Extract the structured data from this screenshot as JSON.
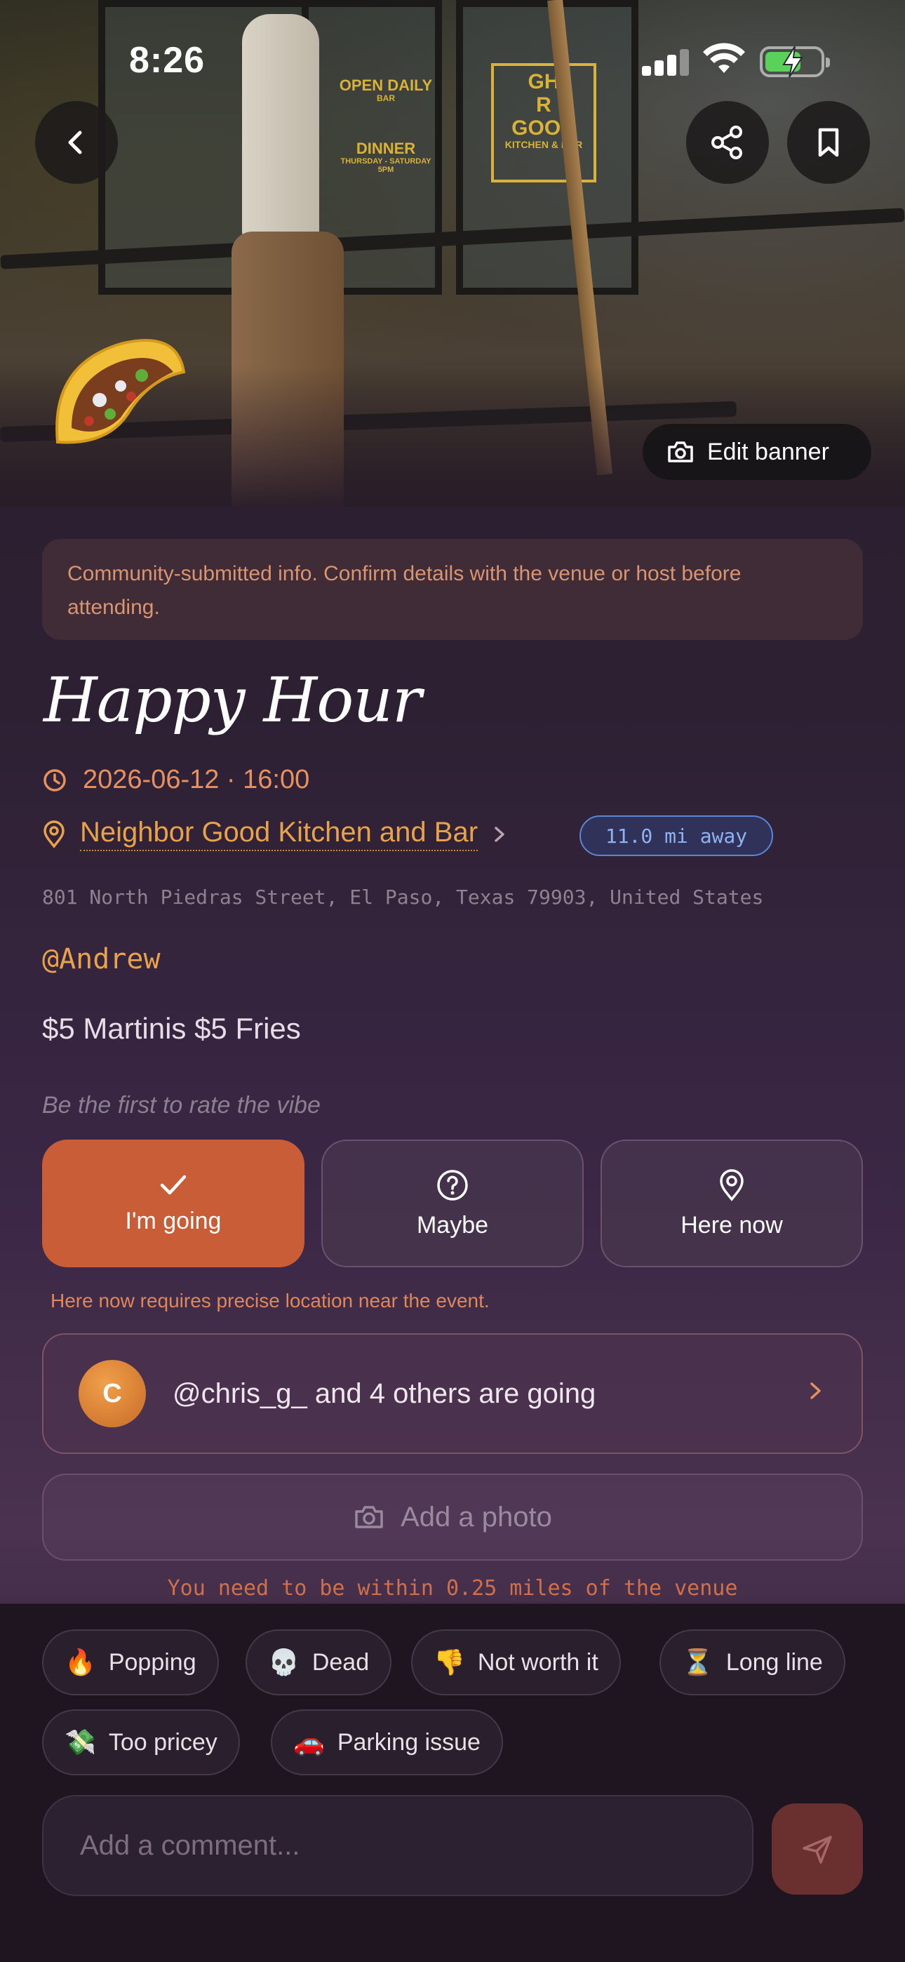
{
  "status_bar": {
    "time": "8:26"
  },
  "banner": {
    "edit_label": "Edit banner",
    "signs": {
      "open_daily": "OPEN DAILY",
      "bar": "BAR",
      "dinner": "DINNER",
      "dinner_days": "THURSDAY - SATURDAY",
      "dinner_time": "5PM",
      "good_1": "GH",
      "good_2": "R",
      "good_3": "GOOD",
      "good_4": "KITCHEN & BAR"
    }
  },
  "notice": "Community-submitted info. Confirm details with the venue or host before attending.",
  "event": {
    "title": "Happy Hour",
    "datetime": "2026-06-12 · 16:00",
    "venue": "Neighbor Good Kitchen and Bar",
    "distance": "11.0 mi away",
    "address": "801 North Piedras Street, El Paso, Texas 79903, United States",
    "host": "@Andrew",
    "description": "$5 Martinis $5 Fries",
    "vibe_prompt": "Be the first to rate the vibe"
  },
  "rsvp": {
    "going": "I'm going",
    "maybe": "Maybe",
    "here_now": "Here now",
    "here_note": "Here now requires precise location near the event."
  },
  "attendees": {
    "avatar_initial": "C",
    "summary": "@chris_g_ and 4 others are going"
  },
  "photo": {
    "add_label": "Add a photo",
    "proximity_note": "You need to be within 0.25 miles of the venue"
  },
  "vibe_chips": [
    {
      "emoji": "🔥",
      "label": "Popping"
    },
    {
      "emoji": "💀",
      "label": "Dead"
    },
    {
      "emoji": "👎",
      "label": "Not worth it"
    },
    {
      "emoji": "⏳",
      "label": "Long line"
    },
    {
      "emoji": "💸",
      "label": "Too pricey"
    },
    {
      "emoji": "🚗",
      "label": "Parking issue"
    }
  ],
  "comment": {
    "placeholder": "Add a comment..."
  },
  "colors": {
    "accent": "#c85d38",
    "venue_link": "#e8a24a",
    "distance_badge": "#5a86d6",
    "background": "#2b1d2d"
  }
}
